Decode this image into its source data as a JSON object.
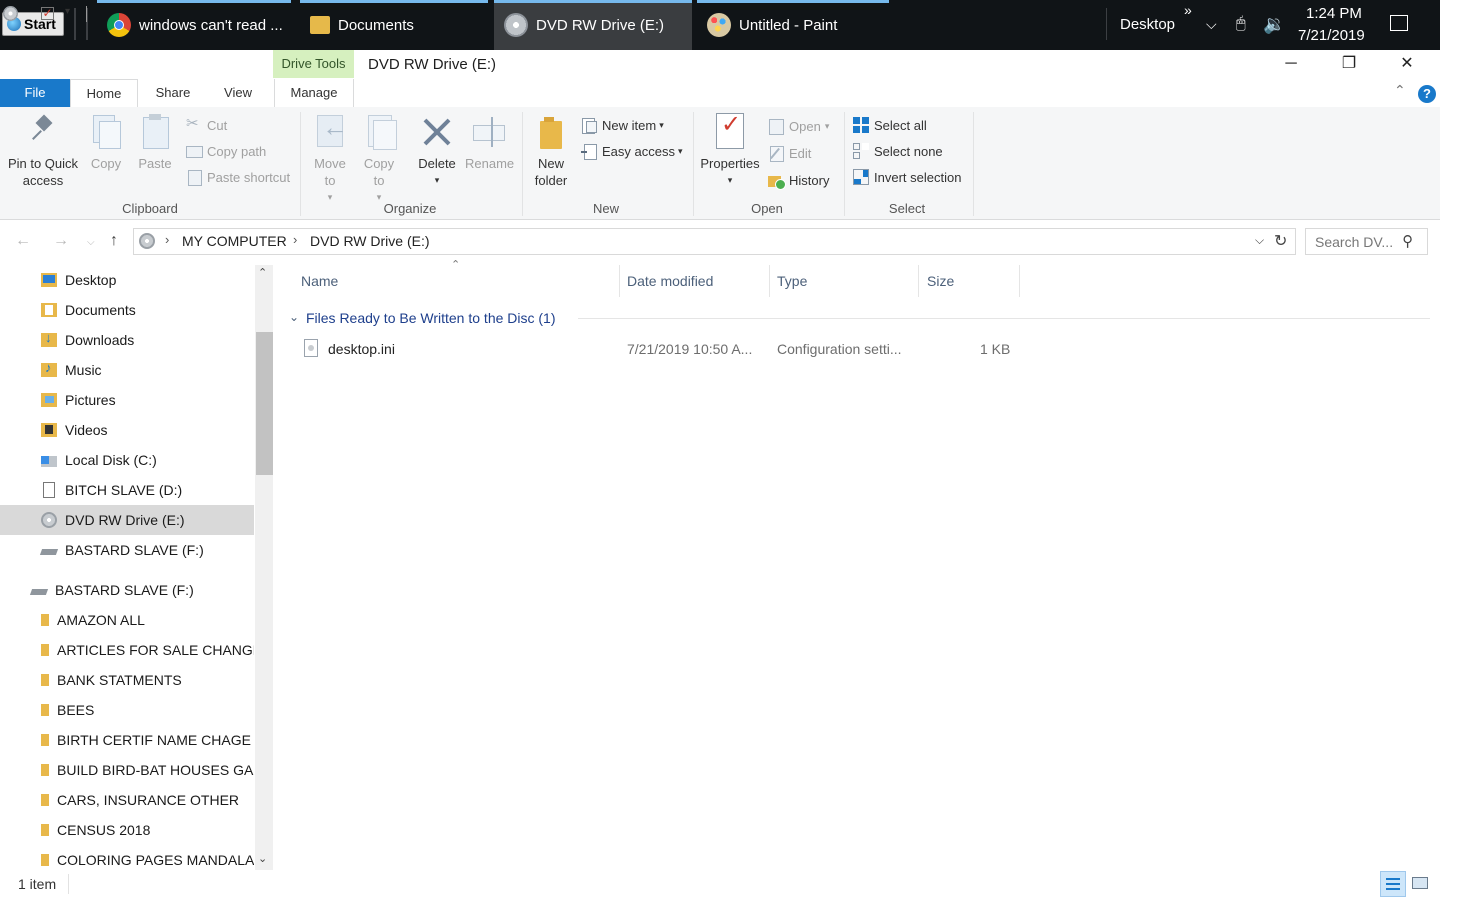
{
  "taskbar": {
    "start_label": "Start",
    "apps": [
      {
        "label": "windows can't read ...",
        "icon": "chrome-icon"
      },
      {
        "label": "Documents",
        "icon": "folder-icon"
      },
      {
        "label": "DVD RW Drive (E:)",
        "icon": "dvd-drive-icon",
        "active": true
      },
      {
        "label": "Untitled - Paint",
        "icon": "paint-icon"
      }
    ],
    "desktop_label": "Desktop",
    "more_chevron": "»",
    "clock_time": "1:24 PM",
    "clock_date": "7/21/2019"
  },
  "window": {
    "title": "DVD RW Drive (E:)",
    "context_tab": "Drive Tools",
    "minimize": "─",
    "restore": "❐",
    "close": "✕"
  },
  "ribbon": {
    "tabs": {
      "file": "File",
      "home": "Home",
      "share": "Share",
      "view": "View",
      "manage": "Manage"
    },
    "clipboard": {
      "pin": "Pin to Quick access",
      "copy": "Copy",
      "paste": "Paste",
      "cut": "Cut",
      "copy_path": "Copy path",
      "paste_shortcut": "Paste shortcut",
      "group": "Clipboard"
    },
    "organize": {
      "move_to": "Move to",
      "copy_to": "Copy to",
      "delete": "Delete",
      "rename": "Rename",
      "group": "Organize"
    },
    "new": {
      "new_folder": "New folder",
      "new_item": "New item",
      "easy_access": "Easy access",
      "group": "New"
    },
    "open": {
      "properties": "Properties",
      "open": "Open",
      "edit": "Edit",
      "history": "History",
      "group": "Open"
    },
    "select": {
      "select_all": "Select all",
      "select_none": "Select none",
      "invert_selection": "Invert selection",
      "group": "Select"
    },
    "help": "?"
  },
  "address": {
    "crumbs": [
      "MY COMPUTER",
      "DVD RW Drive (E:)"
    ],
    "search_placeholder": "Search DV..."
  },
  "nav_pane": {
    "items": [
      {
        "label": "Desktop",
        "icon": "desktop-folder-icon"
      },
      {
        "label": "Documents",
        "icon": "documents-folder-icon"
      },
      {
        "label": "Downloads",
        "icon": "downloads-folder-icon"
      },
      {
        "label": "Music",
        "icon": "music-folder-icon"
      },
      {
        "label": "Pictures",
        "icon": "pictures-folder-icon"
      },
      {
        "label": "Videos",
        "icon": "videos-folder-icon"
      },
      {
        "label": "Local Disk (C:)",
        "icon": "local-disk-icon"
      },
      {
        "label": "BITCH SLAVE (D:)",
        "icon": "blank-drive-icon"
      },
      {
        "label": "DVD RW Drive (E:)",
        "icon": "dvd-drive-icon",
        "selected": true
      },
      {
        "label": "BASTARD SLAVE  (F:)",
        "icon": "usb-drive-icon"
      },
      {
        "label": "BASTARD SLAVE  (F:)",
        "icon": "usb-drive-icon"
      },
      {
        "label": "AMAZON ALL",
        "icon": "folder-icon"
      },
      {
        "label": "ARTICLES FOR SALE CHANGE",
        "icon": "folder-icon"
      },
      {
        "label": "BANK STATMENTS",
        "icon": "folder-icon"
      },
      {
        "label": "BEES",
        "icon": "folder-icon"
      },
      {
        "label": "BIRTH CERTIF NAME CHAGE",
        "icon": "folder-icon"
      },
      {
        "label": "BUILD BIRD-BAT HOUSES GA",
        "icon": "folder-icon"
      },
      {
        "label": "CARS, INSURANCE OTHER",
        "icon": "folder-icon"
      },
      {
        "label": "CENSUS 2018",
        "icon": "folder-icon"
      },
      {
        "label": "COLORING PAGES MANDALA",
        "icon": "folder-icon"
      }
    ]
  },
  "content": {
    "columns": {
      "name": "Name",
      "date": "Date modified",
      "type": "Type",
      "size": "Size"
    },
    "group_header": "Files Ready to Be Written to the Disc (1)",
    "files": [
      {
        "name": "desktop.ini",
        "date": "7/21/2019 10:50 A...",
        "type": "Configuration setti...",
        "size": "1 KB"
      }
    ]
  },
  "status": {
    "item_count": "1 item"
  },
  "colors": {
    "accent": "#1979ca",
    "taskbar": "#101417",
    "drive_tools": "#d6f0bf",
    "selected": "#d9d9d9"
  }
}
